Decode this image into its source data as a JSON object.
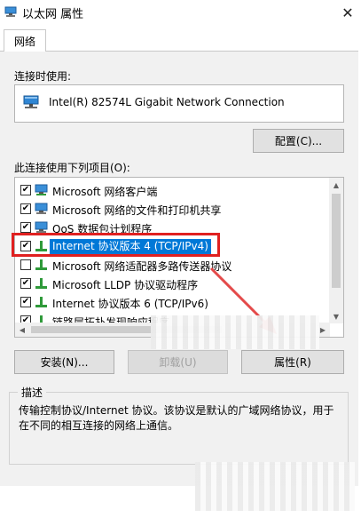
{
  "window": {
    "title": "以太网 属性",
    "close_glyph": "✕"
  },
  "tabs": [
    {
      "label": "网络"
    }
  ],
  "connect_using": {
    "label": "连接时使用:",
    "adapter_name": "Intel(R) 82574L Gigabit Network Connection"
  },
  "buttons": {
    "configure": "配置(C)...",
    "install": "安装(N)...",
    "uninstall": "卸载(U)",
    "properties": "属性(R)"
  },
  "components": {
    "label": "此连接使用下列项目(O):",
    "items": [
      {
        "label": "Microsoft 网络客户端",
        "checked": true,
        "icon": "network-client-icon"
      },
      {
        "label": "Microsoft 网络的文件和打印机共享",
        "checked": true,
        "icon": "network-service-icon"
      },
      {
        "label": "QoS 数据包计划程序",
        "checked": true,
        "icon": "network-service-icon"
      },
      {
        "label": "Internet 协议版本 4 (TCP/IPv4)",
        "checked": true,
        "icon": "protocol-icon",
        "selected": true
      },
      {
        "label": "Microsoft 网络适配器多路传送器协议",
        "checked": false,
        "icon": "protocol-icon"
      },
      {
        "label": "Microsoft LLDP 协议驱动程序",
        "checked": true,
        "icon": "protocol-icon"
      },
      {
        "label": "Internet 协议版本 6 (TCP/IPv6)",
        "checked": true,
        "icon": "protocol-icon"
      },
      {
        "label": "链路层拓扑发现响应程序",
        "checked": true,
        "icon": "protocol-icon"
      }
    ],
    "check_glyph": "✔"
  },
  "description": {
    "title": "描述",
    "text": "传输控制协议/Internet 协议。该协议是默认的广域网络协议，用于在不同的相互连接的网络上通信。"
  },
  "colors": {
    "selection": "#0078d7",
    "highlight": "#e02020",
    "focus": "#3d7fd6"
  }
}
